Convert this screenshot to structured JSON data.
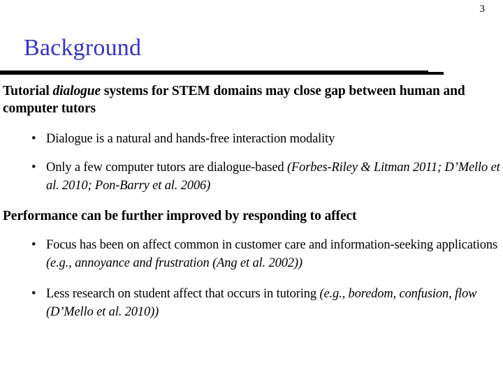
{
  "slide": {
    "number": "3",
    "title": "Background",
    "title_color": "#3333cc",
    "rule_color": "#000000",
    "background_color": "#ffffff"
  },
  "content": {
    "lead_1": {
      "part_1": "Tutorial ",
      "emphasis": "dialogue",
      "part_2": " systems for STEM domains may close gap between human and computer tutors"
    },
    "bullets_1": [
      {
        "marker": "•",
        "text": "Dialogue is a natural and hands-free interaction modality",
        "citation": ""
      },
      {
        "marker": "•",
        "text": "Only a few computer tutors are dialogue-based ",
        "citation": "(Forbes-Riley & Litman 2011;  D’Mello et al. 2010;  Pon-Barry et al. 2006)"
      }
    ],
    "lead_2": {
      "part_1": "Performance can be further improved by responding to affect",
      "emphasis": "",
      "part_2": ""
    },
    "bullets_2": [
      {
        "marker": "•",
        "text": "Focus has been on affect common in customer care and information-seeking applications ",
        "citation": "(e.g., annoyance and frustration (Ang et al. 2002))"
      },
      {
        "marker": "•",
        "text": "Less research on student affect that occurs in tutoring ",
        "citation": "(e.g., boredom, confusion, flow (D’Mello et al. 2010))"
      }
    ]
  }
}
